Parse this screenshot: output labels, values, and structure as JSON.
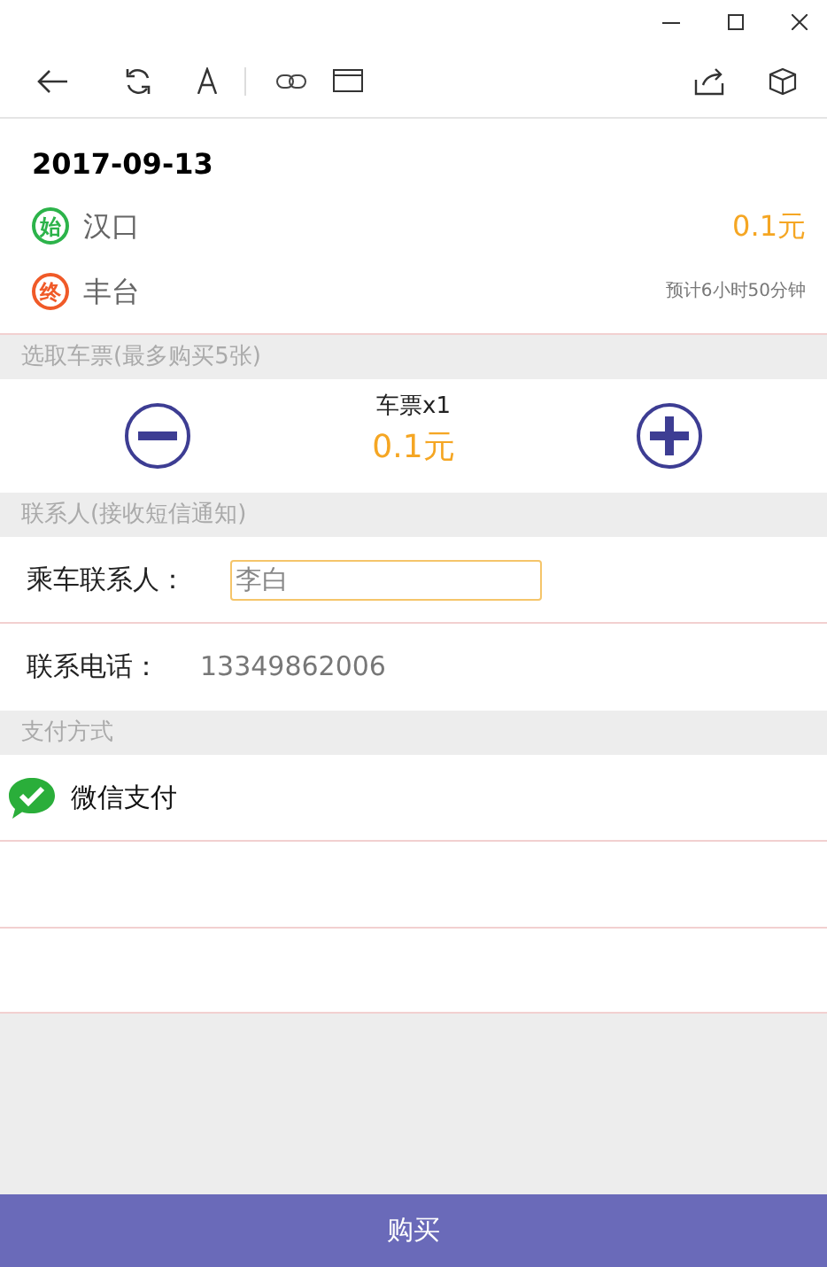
{
  "trip": {
    "date": "2017-09-13",
    "stations": [
      {
        "badge": "始",
        "name": "汉口",
        "info": "0.1元",
        "kind": "price",
        "color": "#2cb34a"
      },
      {
        "badge": "终",
        "name": "丰台",
        "info": "预计6小时50分钟",
        "kind": "duration",
        "color": "#f05a28"
      }
    ]
  },
  "tickets": {
    "header": "选取车票(最多购买5张)",
    "label": "车票x1",
    "price": "0.1元"
  },
  "contact": {
    "header": "联系人(接收短信通知)",
    "name_label": "乘车联系人：",
    "name_value": "李白",
    "phone_label": "联系电话：",
    "phone": "13349862006"
  },
  "payment": {
    "header": "支付方式",
    "methods": [
      {
        "label": "微信支付"
      }
    ]
  },
  "buy_button": "购买"
}
